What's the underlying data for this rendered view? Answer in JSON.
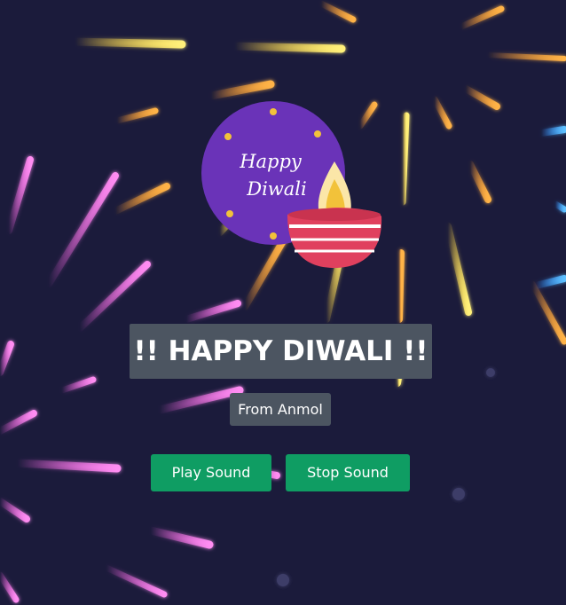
{
  "logo": {
    "line1": "Happy",
    "line2": "Diwali",
    "circle_color": "#6a33b8",
    "dot_color": "#f2c23a",
    "lamp_color": "#e0405e",
    "flame_color": "#f2c23a"
  },
  "greeting": {
    "title": "!! HAPPY DIWALI !!",
    "from": "From Anmol"
  },
  "controls": {
    "play_label": "Play Sound",
    "stop_label": "Stop Sound",
    "button_color": "#0f9d63"
  },
  "theme": {
    "background": "#1b1b3b",
    "box_color": "#4c5561"
  }
}
